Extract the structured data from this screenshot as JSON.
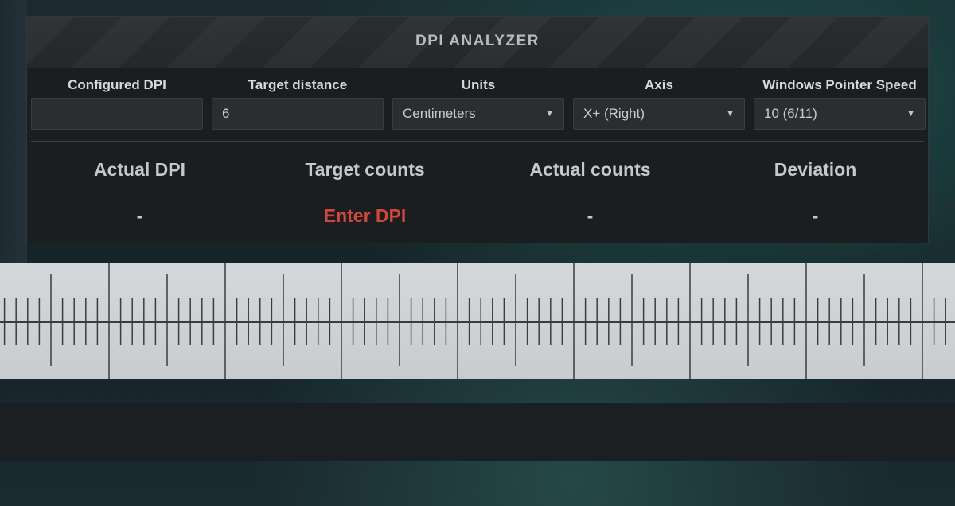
{
  "panel": {
    "title": "DPI ANALYZER"
  },
  "fields": {
    "configured_dpi": {
      "label": "Configured DPI",
      "value": ""
    },
    "target_distance": {
      "label": "Target distance",
      "value": "6"
    },
    "units": {
      "label": "Units",
      "value": "Centimeters"
    },
    "axis": {
      "label": "Axis",
      "value": "X+ (Right)"
    },
    "pointer_speed": {
      "label": "Windows Pointer Speed",
      "value": "10 (6/11)"
    }
  },
  "stats": {
    "actual_dpi": {
      "label": "Actual DPI",
      "value": "-"
    },
    "target_counts": {
      "label": "Target counts",
      "value": "Enter DPI"
    },
    "actual_counts": {
      "label": "Actual counts",
      "value": "-"
    },
    "deviation": {
      "label": "Deviation",
      "value": "-"
    }
  },
  "colors": {
    "alert": "#d0473c",
    "ruler": "#cfd2d4",
    "panel": "#1b1e21"
  }
}
